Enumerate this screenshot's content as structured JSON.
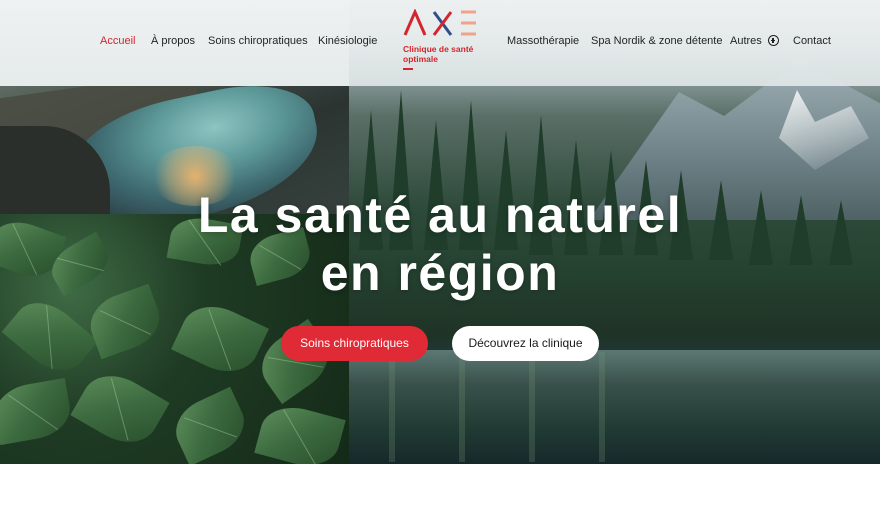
{
  "brand": {
    "name_line1": "Clinique de santé",
    "name_line2": "optimale",
    "accent_color": "#d4252f",
    "logo_colors": [
      "#d4252f",
      "#2e4f8a",
      "#f2a18a"
    ]
  },
  "nav": {
    "left": [
      {
        "label": "Accueil",
        "active": true
      },
      {
        "label": "À propos"
      },
      {
        "label": "Soins chiropratiques"
      },
      {
        "label": "Kinésiologie"
      }
    ],
    "right": [
      {
        "label": "Massothérapie"
      },
      {
        "label": "Spa Nordik & zone détente"
      },
      {
        "label": "Autres",
        "icon": "plus-circle-icon"
      },
      {
        "label": "Contact"
      }
    ]
  },
  "hero": {
    "title_line1": "La santé au naturel",
    "title_line2": "en région",
    "primary_button": "Soins chiropratiques",
    "secondary_button": "Découvrez la clinique",
    "primary_color": "#e02a35"
  }
}
